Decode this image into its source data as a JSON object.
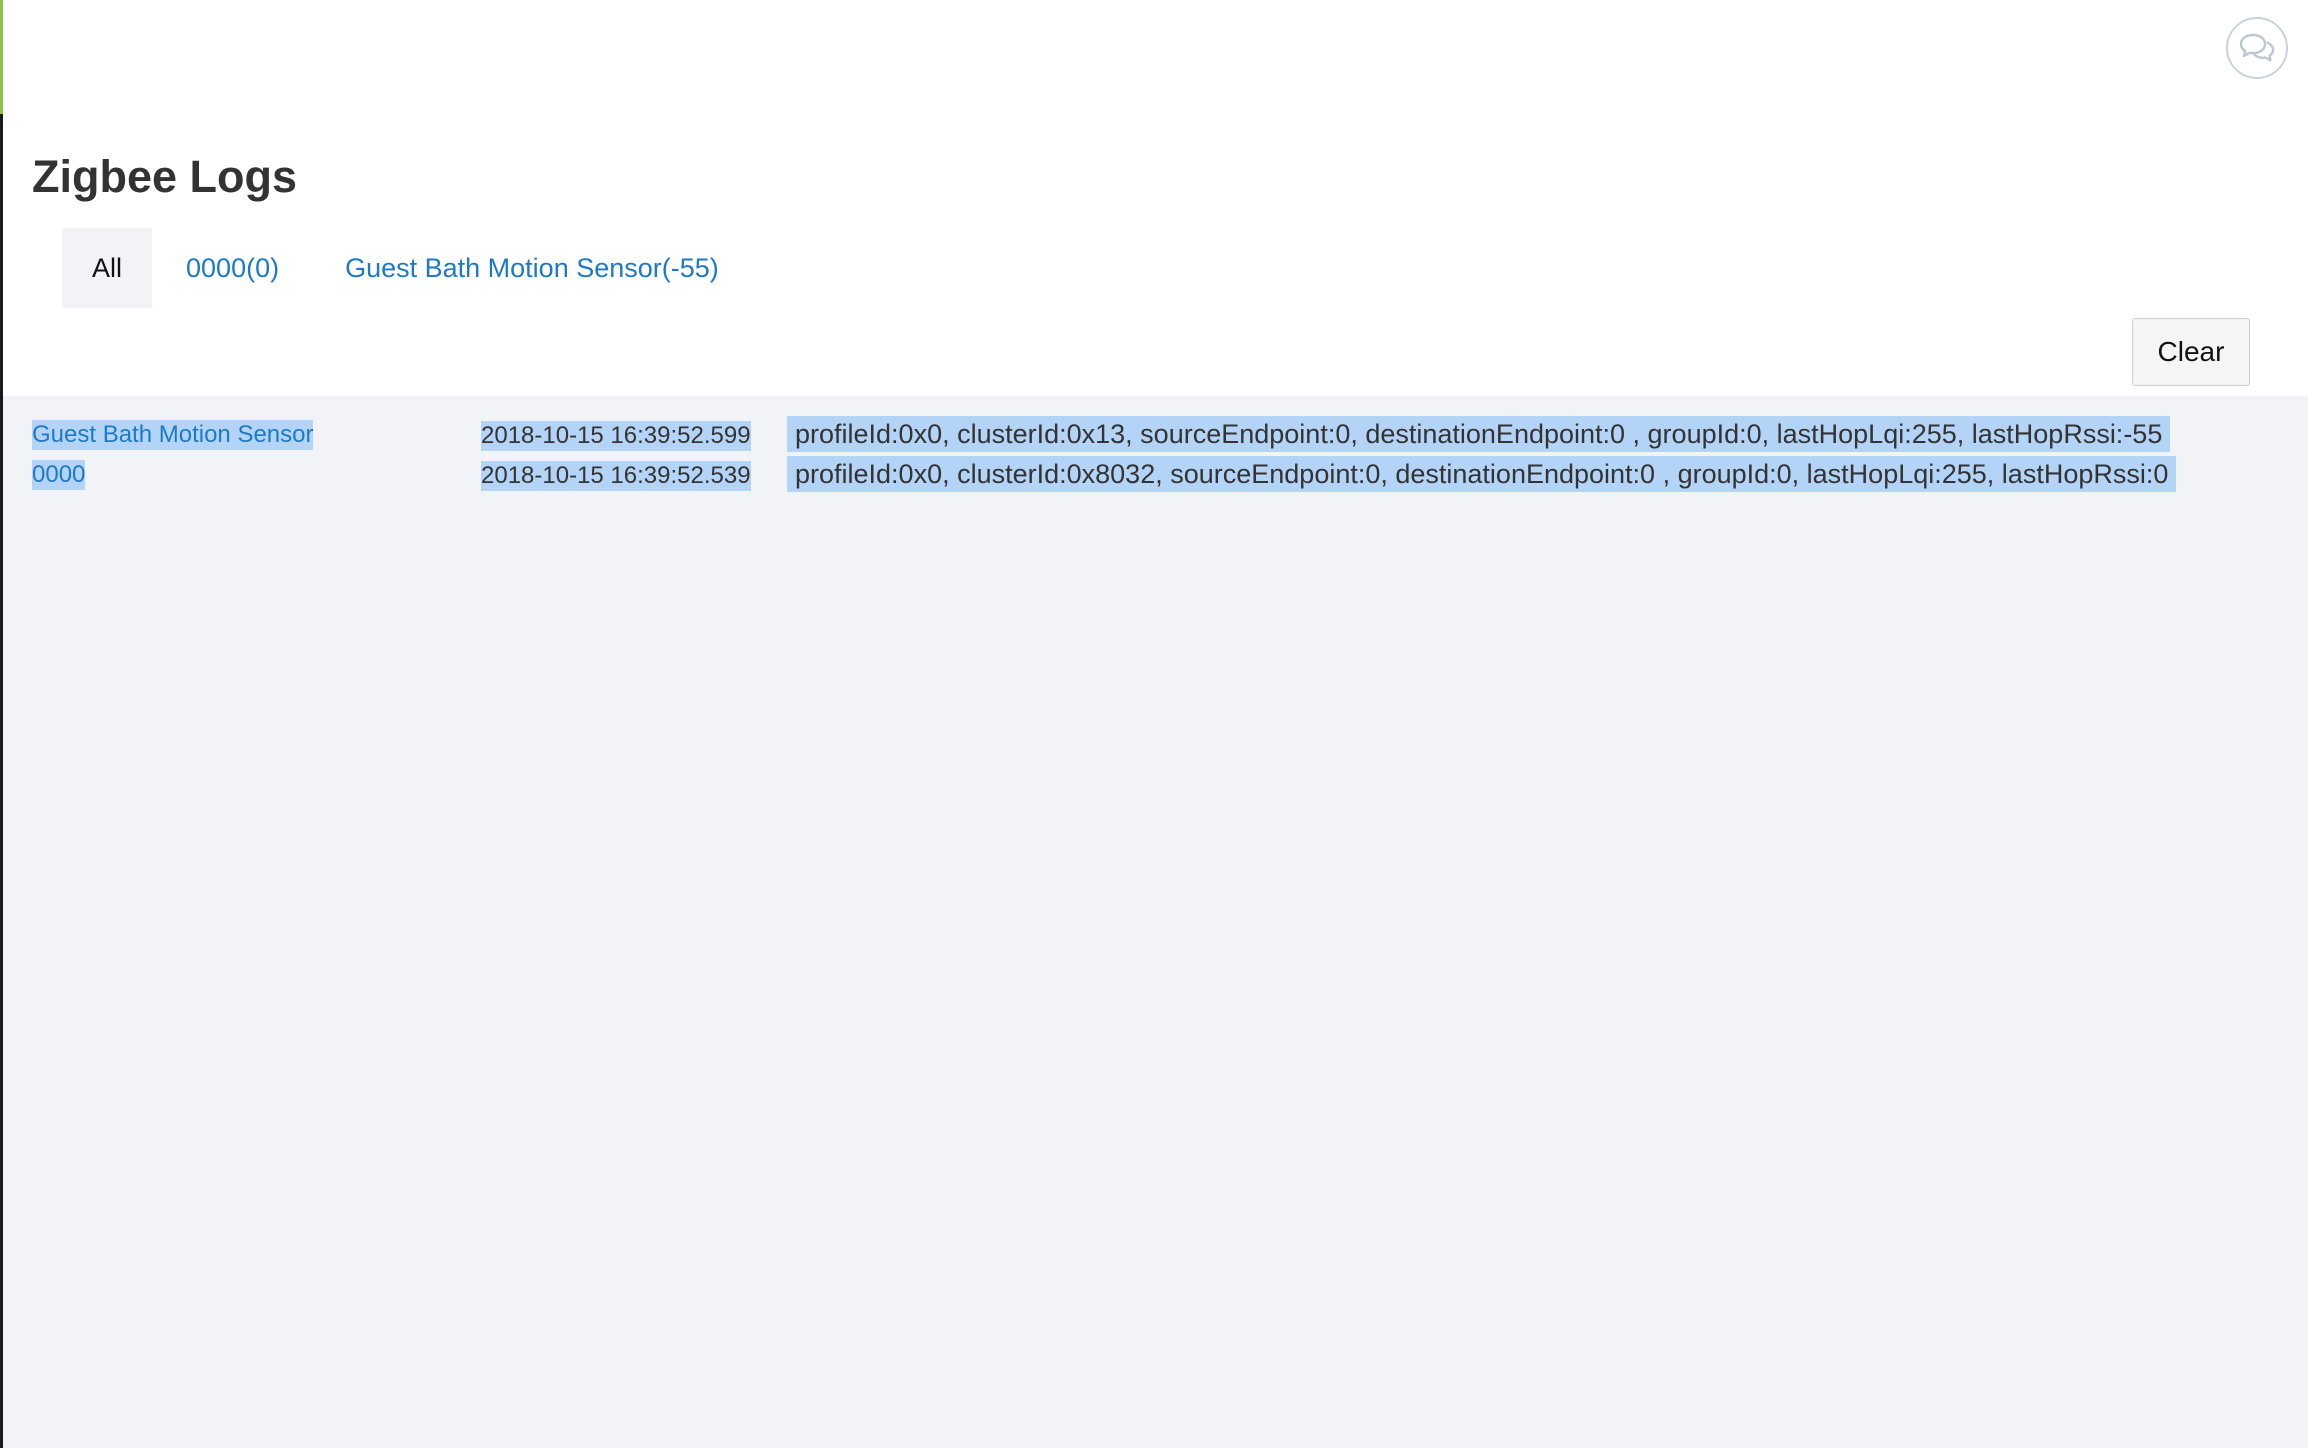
{
  "page": {
    "title": "Zigbee Logs"
  },
  "tabs": [
    {
      "label": "All",
      "active": true
    },
    {
      "label": "0000(0)",
      "active": false
    },
    {
      "label": "Guest Bath Motion Sensor(-55)",
      "active": false
    }
  ],
  "actions": {
    "clear_label": "Clear"
  },
  "logs": [
    {
      "device": "Guest Bath Motion Sensor",
      "timestamp": "2018-10-15 16:39:52.599",
      "message": "profileId:0x0, clusterId:0x13, sourceEndpoint:0, destinationEndpoint:0 , groupId:0, lastHopLqi:255, lastHopRssi:-55"
    },
    {
      "device": "0000",
      "timestamp": "2018-10-15 16:39:52.539",
      "message": "profileId:0x0, clusterId:0x8032, sourceEndpoint:0, destinationEndpoint:0 , groupId:0, lastHopLqi:255, lastHopRssi:0"
    }
  ],
  "icons": {
    "chat": "chat-bubbles-icon"
  },
  "colors": {
    "link": "#1d7ac9",
    "accent": "#8cc43f",
    "selection": "#b4d4f7",
    "log_background": "#f2f3f7"
  }
}
